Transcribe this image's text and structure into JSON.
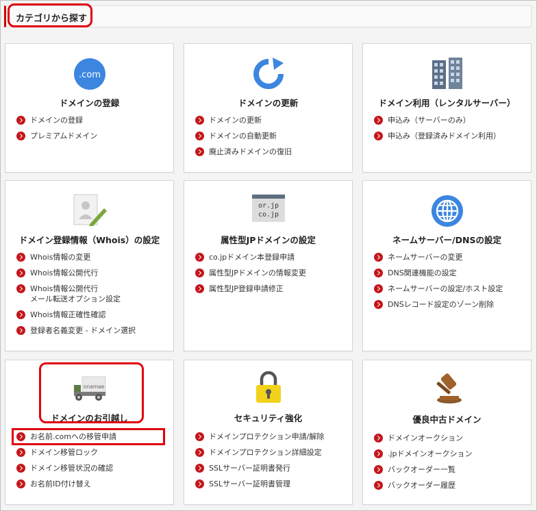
{
  "header": {
    "title": "カテゴリから探す"
  },
  "cards": [
    {
      "title": "ドメインの登録",
      "icon": "dotcom-icon",
      "icon_text": ".com",
      "links": [
        "ドメインの登録",
        "プレミアムドメイン"
      ]
    },
    {
      "title": "ドメインの更新",
      "icon": "renew-arrow-icon",
      "links": [
        "ドメインの更新",
        "ドメインの自動更新",
        "廃止済みドメインの復旧"
      ]
    },
    {
      "title": "ドメイン利用（レンタルサーバー）",
      "icon": "server-icon",
      "links": [
        "申込み（サーバーのみ）",
        "申込み（登録済みドメイン利用）"
      ]
    },
    {
      "title": "ドメイン登録情報（Whois）の設定",
      "icon": "profile-edit-icon",
      "links": [
        "Whois情報の変更",
        "Whois情報公開代行",
        "Whois情報公開代行\nメール転送オプション設定",
        "Whois情報正確性確認",
        "登録者名義変更 - ドメイン選択"
      ]
    },
    {
      "title": "属性型JPドメインの設定",
      "icon": "jp-domain-icon",
      "icon_lines": [
        "or.jp",
        "co.jp"
      ],
      "links": [
        "co.jpドメイン本登録申請",
        "属性型JPドメインの情報変更",
        "属性型JP登録申請修正"
      ]
    },
    {
      "title": "ネームサーバー/DNSの設定",
      "icon": "globe-icon",
      "links": [
        "ネームサーバーの変更",
        "DNS関連機能の設定",
        "ネームサーバーの設定/ホスト設定",
        "DNSレコード設定のゾーン削除"
      ]
    },
    {
      "title": "ドメインのお引越し",
      "icon": "moving-truck-icon",
      "icon_text": "onamae",
      "links": [
        "お名前.comへの移管申請",
        "ドメイン移管ロック",
        "ドメイン移管状況の確認",
        "お名前ID付け替え"
      ]
    },
    {
      "title": "セキュリティ強化",
      "icon": "padlock-icon",
      "links": [
        "ドメインプロテクション申請/解除",
        "ドメインプロテクション詳細設定",
        "SSLサーバー証明書発行",
        "SSLサーバー証明書管理"
      ]
    },
    {
      "title": "優良中古ドメイン",
      "icon": "auction-gavel-icon",
      "links": [
        "ドメインオークション",
        ".jpドメインオークション",
        "バックオーダー一覧",
        "バックオーダー履歴"
      ]
    }
  ],
  "colors": {
    "accent": "#c4161c",
    "highlight": "#e0000e",
    "icon_blue": "#3c86e0"
  }
}
